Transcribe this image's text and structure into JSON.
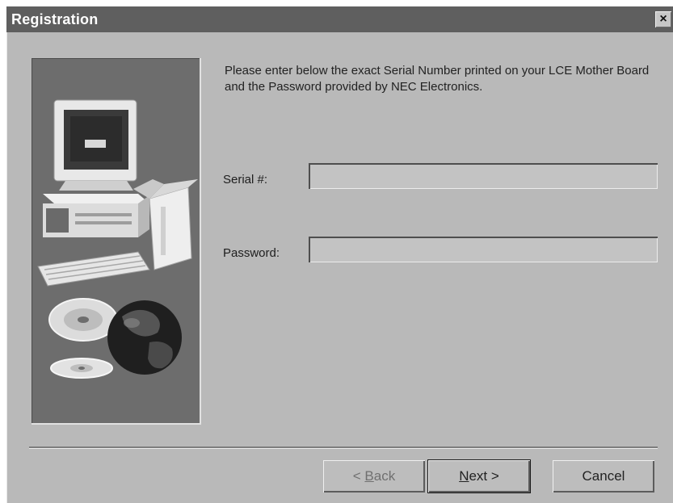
{
  "window": {
    "title": "Registration",
    "close_glyph": "×"
  },
  "instructions": "Please enter below the exact Serial Number printed on your LCE Mother Board and the Password provided by NEC Electronics.",
  "form": {
    "serial_label": "Serial #:",
    "serial_value": "",
    "password_label": "Password:",
    "password_value": ""
  },
  "buttons": {
    "back": {
      "prefix": "< ",
      "mnemonic": "B",
      "rest": "ack"
    },
    "next": {
      "mnemonic": "N",
      "rest": "ext",
      "suffix": " >"
    },
    "cancel": "Cancel"
  },
  "side_image": {
    "icons": [
      "monitor-icon",
      "computer-box-icon",
      "keyboard-icon",
      "cd-disc-icon",
      "globe-icon"
    ]
  },
  "colors": {
    "titlebar": "#5f5f5f",
    "dialog_bg": "#b9b9b9",
    "side_panel": "#6d6d6d"
  }
}
